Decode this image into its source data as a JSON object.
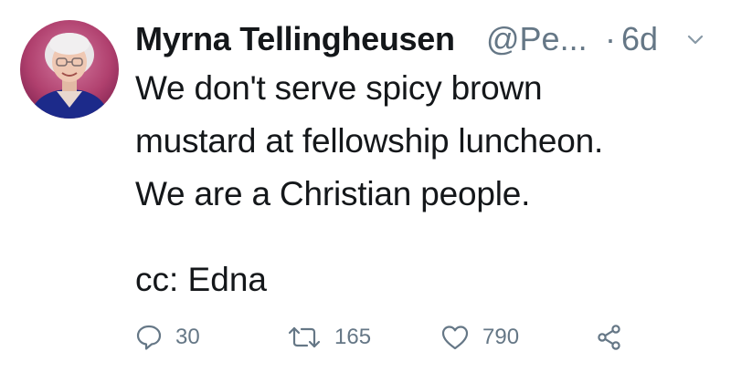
{
  "tweet": {
    "author": {
      "display_name": "Myrna Tellingheusen",
      "handle": "@Pe...",
      "avatar_icon": "profile-photo"
    },
    "separator": "·",
    "time": "6d",
    "text_lines": [
      "We don't serve spicy brown",
      "mustard at fellowship luncheon.",
      "We are a Christian people."
    ],
    "cc": "cc:  Edna",
    "actions": {
      "reply": {
        "icon": "reply-icon",
        "count": "30"
      },
      "retweet": {
        "icon": "retweet-icon",
        "count": "165"
      },
      "like": {
        "icon": "heart-icon",
        "count": "790"
      },
      "share": {
        "icon": "share-icon"
      }
    }
  },
  "colors": {
    "text": "#14171a",
    "secondary": "#657786",
    "background": "#ffffff",
    "avatar_background": "#b0406e"
  }
}
